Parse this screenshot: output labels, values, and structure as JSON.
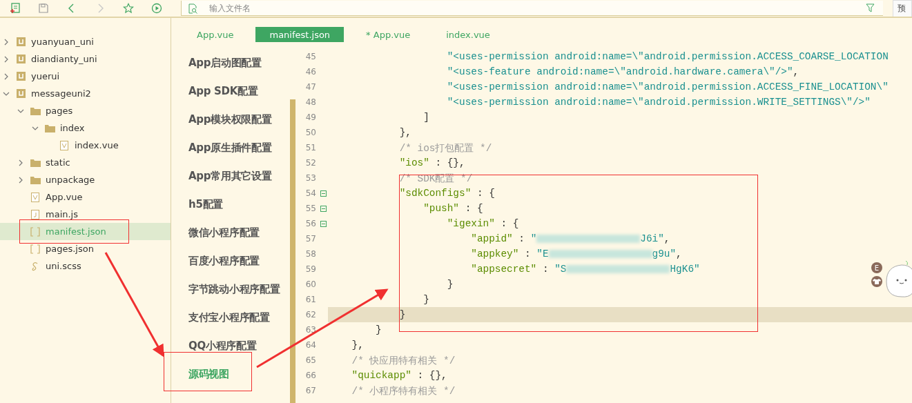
{
  "toolbar": {
    "icons": [
      {
        "kind": "new-file",
        "disabled": false
      },
      {
        "kind": "save",
        "disabled": false
      },
      {
        "kind": "back",
        "disabled": false
      },
      {
        "kind": "forward",
        "disabled": true
      },
      {
        "kind": "favorite",
        "disabled": false
      },
      {
        "kind": "run",
        "disabled": false
      }
    ],
    "search": {
      "placeholder": "输入文件名"
    },
    "preview_button": "预"
  },
  "sidebar": {
    "items": [
      {
        "label": "yuanyuan_uni",
        "kind": "project",
        "expanded": false,
        "selected": false
      },
      {
        "label": "diandianty_uni",
        "kind": "project",
        "expanded": false,
        "selected": false
      },
      {
        "label": "yuerui",
        "kind": "project",
        "expanded": false,
        "selected": false
      },
      {
        "label": "messageuni2",
        "kind": "project",
        "expanded": true,
        "selected": false,
        "children": [
          {
            "label": "pages",
            "kind": "folder",
            "expanded": true,
            "selected": false,
            "children": [
              {
                "label": "index",
                "kind": "folder",
                "expanded": true,
                "selected": false,
                "children": [
                  {
                    "label": "index.vue",
                    "kind": "vue",
                    "selected": false
                  }
                ]
              }
            ]
          },
          {
            "label": "static",
            "kind": "folder",
            "expanded": false,
            "selected": false
          },
          {
            "label": "unpackage",
            "kind": "folder",
            "expanded": false,
            "selected": false
          },
          {
            "label": "App.vue",
            "kind": "vue",
            "selected": false
          },
          {
            "label": "main.js",
            "kind": "js",
            "selected": false
          },
          {
            "label": "manifest.json",
            "kind": "json",
            "selected": true
          },
          {
            "label": "pages.json",
            "kind": "json",
            "selected": false
          },
          {
            "label": "uni.scss",
            "kind": "scss",
            "selected": false
          }
        ]
      }
    ]
  },
  "tabs": [
    {
      "label": "App.vue",
      "selected": false
    },
    {
      "label": "manifest.json",
      "selected": true
    },
    {
      "label": "* App.vue",
      "selected": false
    },
    {
      "label": "index.vue",
      "selected": false
    }
  ],
  "settings_nav": [
    {
      "label": "App启动图配置",
      "selected": false
    },
    {
      "label": "App SDK配置",
      "selected": false
    },
    {
      "label": "App模块权限配置",
      "selected": false
    },
    {
      "label": "App原生插件配置",
      "selected": false
    },
    {
      "label": "App常用其它设置",
      "selected": false
    },
    {
      "label": "h5配置",
      "selected": false
    },
    {
      "label": "微信小程序配置",
      "selected": false
    },
    {
      "label": "百度小程序配置",
      "selected": false
    },
    {
      "label": "字节跳动小程序配置",
      "selected": false
    },
    {
      "label": "支付宝小程序配置",
      "selected": false
    },
    {
      "label": "QQ小程序配置",
      "selected": false
    },
    {
      "label": "源码视图",
      "selected": true
    }
  ],
  "editor": {
    "lines": [
      {
        "number": "45",
        "fold_start": false,
        "current": false,
        "tokens": [
          {
            "kind": "string",
            "text": "                    \"<uses-permission android:name=\\\"android.permission.ACCESS_COARSE_LOCATION"
          }
        ]
      },
      {
        "number": "46",
        "fold_start": false,
        "current": false,
        "tokens": [
          {
            "kind": "string",
            "text": "                    \"<uses-feature android:name=\\\"android.hardware.camera\\\"/>\""
          },
          {
            "kind": "punct",
            "text": ","
          }
        ]
      },
      {
        "number": "47",
        "fold_start": false,
        "current": false,
        "tokens": [
          {
            "kind": "string",
            "text": "                    \"<uses-permission android:name=\\\"android.permission.ACCESS_FINE_LOCATION\\\""
          }
        ]
      },
      {
        "number": "48",
        "fold_start": false,
        "current": false,
        "tokens": [
          {
            "kind": "string",
            "text": "                    \"<uses-permission android:name=\\\"android.permission.WRITE_SETTINGS\\\"/>\""
          }
        ]
      },
      {
        "number": "49",
        "fold_start": false,
        "current": false,
        "tokens": [
          {
            "kind": "punct",
            "text": "                ]"
          }
        ]
      },
      {
        "number": "50",
        "fold_start": false,
        "current": false,
        "tokens": [
          {
            "kind": "punct",
            "text": "            },"
          }
        ]
      },
      {
        "number": "51",
        "fold_start": false,
        "current": false,
        "tokens": [
          {
            "kind": "comment",
            "text": "            /* ios打包配置 */"
          }
        ]
      },
      {
        "number": "52",
        "fold_start": false,
        "current": false,
        "tokens": [
          {
            "kind": "key",
            "text": "            \"ios\""
          },
          {
            "kind": "punct",
            "text": " : {},"
          }
        ]
      },
      {
        "number": "53",
        "fold_start": false,
        "current": false,
        "tokens": [
          {
            "kind": "comment",
            "text": "            /* SDK配置 */"
          }
        ]
      },
      {
        "number": "54",
        "fold_start": true,
        "current": false,
        "tokens": [
          {
            "kind": "key",
            "text": "            \"sdkConfigs\""
          },
          {
            "kind": "punct",
            "text": " : {"
          }
        ]
      },
      {
        "number": "55",
        "fold_start": true,
        "current": false,
        "tokens": [
          {
            "kind": "key",
            "text": "                \"push\""
          },
          {
            "kind": "punct",
            "text": " : {"
          }
        ]
      },
      {
        "number": "56",
        "fold_start": true,
        "current": false,
        "tokens": [
          {
            "kind": "key",
            "text": "                    \"igexin\""
          },
          {
            "kind": "punct",
            "text": " : {"
          }
        ]
      },
      {
        "number": "57",
        "fold_start": false,
        "current": false,
        "tokens": [
          {
            "kind": "key",
            "text": "                        \"appid\""
          },
          {
            "kind": "punct",
            "text": " : "
          },
          {
            "kind": "string",
            "text": "\""
          },
          {
            "kind": "redacted"
          },
          {
            "kind": "string",
            "text": "J6i\""
          },
          {
            "kind": "punct",
            "text": ","
          }
        ]
      },
      {
        "number": "58",
        "fold_start": false,
        "current": false,
        "tokens": [
          {
            "kind": "key",
            "text": "                        \"appkey\""
          },
          {
            "kind": "punct",
            "text": " : "
          },
          {
            "kind": "string",
            "text": "\"E"
          },
          {
            "kind": "redacted"
          },
          {
            "kind": "string",
            "text": "g9u\""
          },
          {
            "kind": "punct",
            "text": ","
          }
        ]
      },
      {
        "number": "59",
        "fold_start": false,
        "current": false,
        "tokens": [
          {
            "kind": "key",
            "text": "                        \"appsecret\""
          },
          {
            "kind": "punct",
            "text": " : "
          },
          {
            "kind": "string",
            "text": "\"S"
          },
          {
            "kind": "redacted"
          },
          {
            "kind": "string",
            "text": "HgK6\""
          }
        ]
      },
      {
        "number": "60",
        "fold_start": false,
        "current": false,
        "tokens": [
          {
            "kind": "punct",
            "text": "                    }"
          }
        ]
      },
      {
        "number": "61",
        "fold_start": false,
        "current": false,
        "tokens": [
          {
            "kind": "punct",
            "text": "                }"
          }
        ]
      },
      {
        "number": "62",
        "fold_start": false,
        "current": true,
        "tokens": [
          {
            "kind": "punct",
            "text": "            }"
          }
        ]
      },
      {
        "number": "63",
        "fold_start": false,
        "current": false,
        "tokens": [
          {
            "kind": "punct",
            "text": "        }"
          }
        ]
      },
      {
        "number": "64",
        "fold_start": false,
        "current": false,
        "tokens": [
          {
            "kind": "punct",
            "text": "    },"
          }
        ]
      },
      {
        "number": "65",
        "fold_start": false,
        "current": false,
        "tokens": [
          {
            "kind": "comment",
            "text": "    /* 快应用特有相关 */"
          }
        ]
      },
      {
        "number": "66",
        "fold_start": false,
        "current": false,
        "tokens": [
          {
            "kind": "key",
            "text": "    \"quickapp\""
          },
          {
            "kind": "punct",
            "text": " : {},"
          }
        ]
      },
      {
        "number": "67",
        "fold_start": false,
        "current": false,
        "tokens": [
          {
            "kind": "comment",
            "text": "    /* 小程序特有相关 */"
          }
        ]
      }
    ]
  },
  "sticker": {
    "badge": "E"
  }
}
